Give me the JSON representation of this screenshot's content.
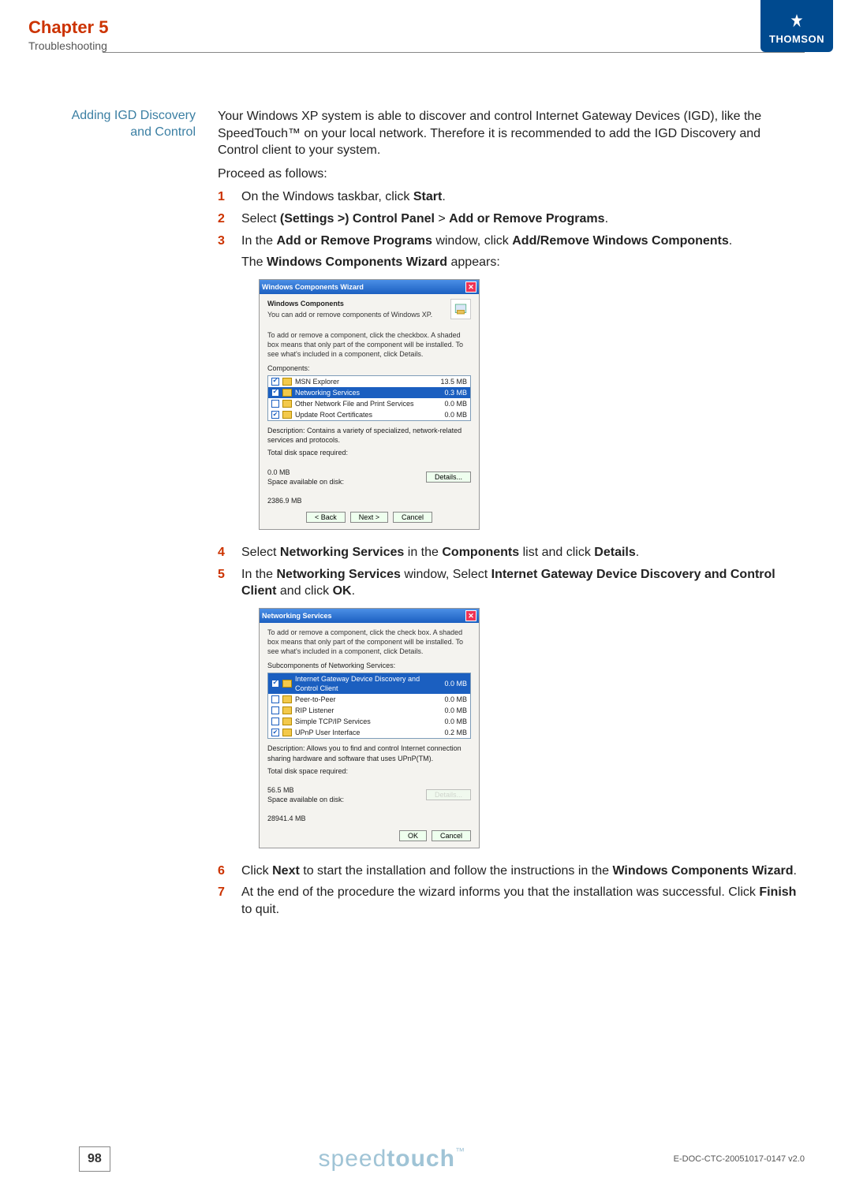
{
  "header": {
    "chapter": "Chapter 5",
    "subtitle": "Troubleshooting",
    "logo_text": "THOMSON"
  },
  "section": {
    "side_title_l1": "Adding IGD Discovery",
    "side_title_l2": "and Control",
    "intro": "Your Windows XP system is able to discover and control Internet Gateway Devices (IGD), like the SpeedTouch™ on your local network. Therefore it is recommended to add the IGD Discovery and Control client to your system.",
    "proceed": "Proceed as follows:"
  },
  "steps": {
    "s1": {
      "num": "1",
      "p1": "On the Windows taskbar, click ",
      "b1": "Start",
      "p2": "."
    },
    "s2": {
      "num": "2",
      "p1": "Select ",
      "b1": "(Settings >) Control Panel",
      "p2": " > ",
      "b2": "Add or Remove Programs",
      "p3": "."
    },
    "s3": {
      "num": "3",
      "p1": "In the ",
      "b1": "Add or Remove Programs",
      "p2": " window, click ",
      "b2": "Add/Remove Windows Components",
      "p3": ".",
      "after": "The ",
      "b3": "Windows Components Wizard",
      "after2": " appears:"
    },
    "s4": {
      "num": "4",
      "p1": "Select ",
      "b1": "Networking Services",
      "p2": " in the ",
      "b2": "Components",
      "p3": " list and click ",
      "b3": "Details",
      "p4": "."
    },
    "s5": {
      "num": "5",
      "p1": "In the ",
      "b1": "Networking Services",
      "p2": " window, Select ",
      "b2": "Internet Gateway Device Discovery and Control Client",
      "p3": " and click ",
      "b3": "OK",
      "p4": "."
    },
    "s6": {
      "num": "6",
      "p1": "Click ",
      "b1": "Next",
      "p2": " to start the installation and follow the instructions in the ",
      "b2": "Windows Components Wizard",
      "p3": "."
    },
    "s7": {
      "num": "7",
      "p1": "At the end of the procedure the wizard informs you that the installation was successful. Click ",
      "b1": "Finish",
      "p2": " to quit."
    }
  },
  "dlg1": {
    "title": "Windows Components Wizard",
    "heading": "Windows Components",
    "sub": "You can add or remove components of Windows XP.",
    "help": "To add or remove a component, click the checkbox. A shaded box means that only part of the component will be installed. To see what's included in a component, click Details.",
    "list_label": "Components:",
    "rows": [
      {
        "checked": true,
        "name": "MSN Explorer",
        "size": "13.5 MB",
        "sel": false
      },
      {
        "checked": true,
        "name": "Networking Services",
        "size": "0.3 MB",
        "sel": true
      },
      {
        "checked": false,
        "name": "Other Network File and Print Services",
        "size": "0.0 MB",
        "sel": false
      },
      {
        "checked": true,
        "name": "Update Root Certificates",
        "size": "0.0 MB",
        "sel": false
      }
    ],
    "desc_label": "Description:",
    "desc": "Contains a variety of specialized, network-related services and protocols.",
    "total_label": "Total disk space required:",
    "total_val": "0.0 MB",
    "avail_label": "Space available on disk:",
    "avail_val": "2386.9 MB",
    "btn_details": "Details...",
    "btn_back": "< Back",
    "btn_next": "Next >",
    "btn_cancel": "Cancel"
  },
  "dlg2": {
    "title": "Networking Services",
    "help": "To add or remove a component, click the check box. A shaded box means that only part of the component will be installed. To see what's included in a component, click Details.",
    "list_label": "Subcomponents of Networking Services:",
    "rows": [
      {
        "checked": true,
        "name": "Internet Gateway Device Discovery and Control Client",
        "size": "0.0 MB",
        "sel": true
      },
      {
        "checked": false,
        "name": "Peer-to-Peer",
        "size": "0.0 MB",
        "sel": false
      },
      {
        "checked": false,
        "name": "RIP Listener",
        "size": "0.0 MB",
        "sel": false
      },
      {
        "checked": false,
        "name": "Simple TCP/IP Services",
        "size": "0.0 MB",
        "sel": false
      },
      {
        "checked": true,
        "name": "UPnP User Interface",
        "size": "0.2 MB",
        "sel": false
      }
    ],
    "desc_label": "Description:",
    "desc": "Allows you to find and control Internet connection sharing hardware and software that uses UPnP(TM).",
    "total_label": "Total disk space required:",
    "total_val": "56.5 MB",
    "avail_label": "Space available on disk:",
    "avail_val": "28941.4 MB",
    "btn_details": "Details...",
    "btn_ok": "OK",
    "btn_cancel": "Cancel"
  },
  "footer": {
    "page": "98",
    "brand1": "speed",
    "brand2": "touch",
    "tm": "™",
    "docid": "E-DOC-CTC-20051017-0147 v2.0"
  }
}
